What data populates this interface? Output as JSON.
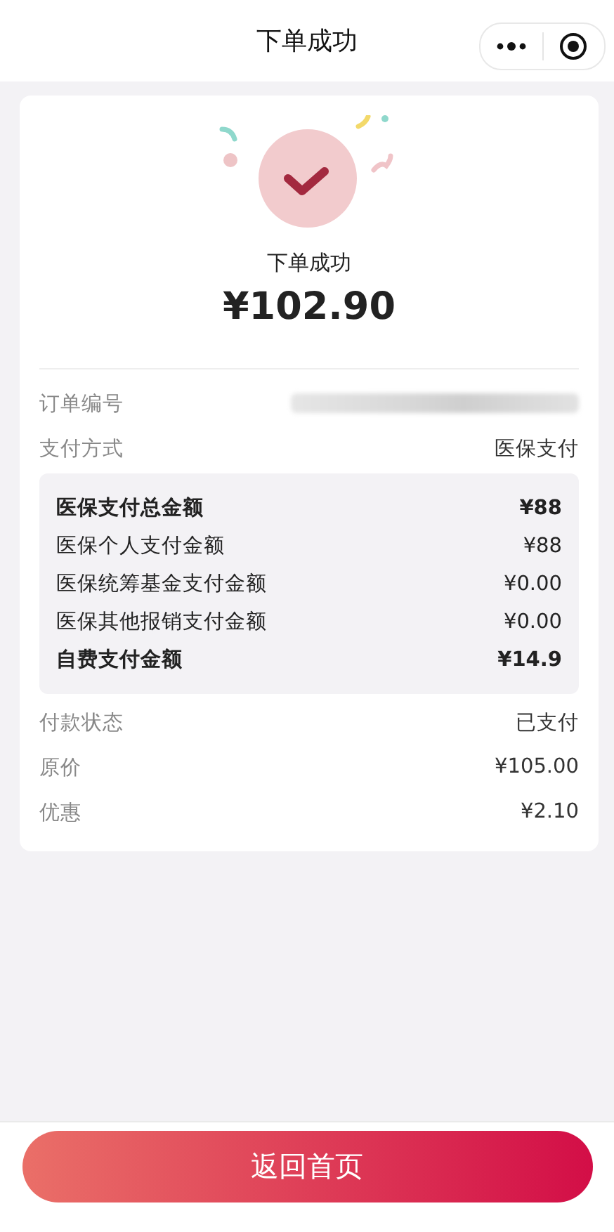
{
  "nav": {
    "title": "下单成功"
  },
  "result": {
    "status": "下单成功",
    "amount": "¥102.90"
  },
  "info_rows": [
    {
      "kind": "redacted",
      "label": "订单编号"
    },
    {
      "kind": "text",
      "label": "支付方式",
      "value": "医保支付"
    }
  ],
  "breakdown": [
    {
      "label": "医保支付总金额",
      "value": "¥88",
      "bold": true
    },
    {
      "label": "医保个人支付金额",
      "value": "¥88",
      "bold": false
    },
    {
      "label": "医保统筹基金支付金额",
      "value": "¥0.00",
      "bold": false
    },
    {
      "label": "医保其他报销支付金额",
      "value": "¥0.00",
      "bold": false
    },
    {
      "label": "自费支付金额",
      "value": "¥14.9",
      "bold": true
    }
  ],
  "extra_rows": [
    {
      "label": "付款状态",
      "value": "已支付"
    },
    {
      "label": "原价",
      "value": "¥105.00"
    },
    {
      "label": "优惠",
      "value": "¥2.10"
    }
  ],
  "button": {
    "label": "返回首页"
  }
}
